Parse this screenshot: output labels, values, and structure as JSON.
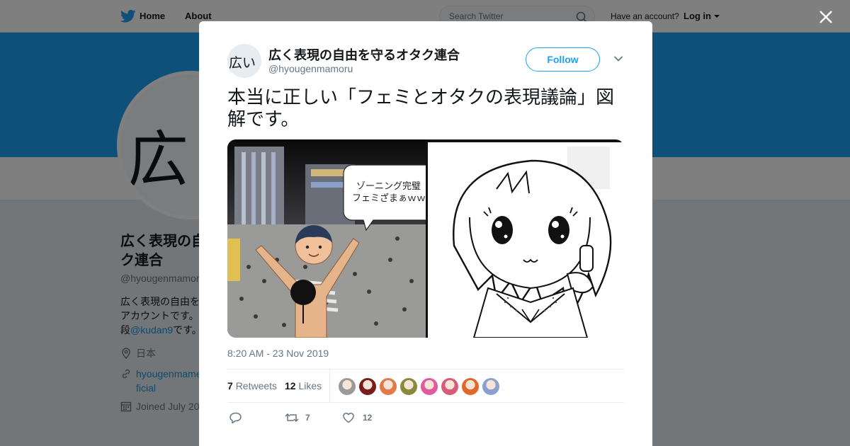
{
  "header": {
    "home_label": "Home",
    "about_label": "About",
    "search_placeholder": "Search Twitter",
    "have_account": "Have an account?",
    "login_label": "Log in"
  },
  "profile": {
    "avatar_glyph": "広",
    "name": "広く表現の自由を守るオタク連合",
    "name_visible_line1": "広く表現の自",
    "name_visible_line2": "ク連合",
    "handle": "@hyougenmamoru",
    "handle_visible": "@hyougenmamor",
    "bio_line1": "広く表現の自由を",
    "bio_line2": "アカウントです。",
    "bio_line3_prefix": "段",
    "bio_mention": "@kudan9",
    "bio_line3_suffix": "です。",
    "location": "日本",
    "url_line1": "hyougenmame",
    "url_line2": "ficial",
    "joined": "Joined July 20"
  },
  "modal": {
    "avatar_text": "広い",
    "display_name": "広く表現の自由を守るオタク連合",
    "handle": "@hyougenmamoru",
    "follow_label": "Follow",
    "tweet_text": "本当に正しい「フェミとオタクの表現議論」図解です。",
    "media_left_bubble_line1": "ゾーニング完璧",
    "media_left_bubble_line2": "フェミざまぁｗｗ",
    "timestamp": "8:20 AM - 23 Nov 2019",
    "retweets_count": "7",
    "retweets_label": "Retweets",
    "likes_count": "12",
    "likes_label": "Likes",
    "reply_count": "",
    "retweet_action_count": "7",
    "like_action_count": "12",
    "liker_colors": [
      "#9a9a9a",
      "#7a1c1c",
      "#e07a4a",
      "#8a8a3a",
      "#e05aa0",
      "#d85a7a",
      "#e0682a",
      "#8aa0d0"
    ]
  },
  "colors": {
    "brand_blue": "#1da1f2",
    "link_blue": "#1b95e0",
    "secondary_text": "#657786"
  },
  "icons": {
    "logo": "twitter-bird-icon",
    "search": "search-icon",
    "close": "close-icon",
    "caret": "chevron-down-icon",
    "reply": "reply-icon",
    "retweet": "retweet-icon",
    "like": "heart-icon"
  }
}
